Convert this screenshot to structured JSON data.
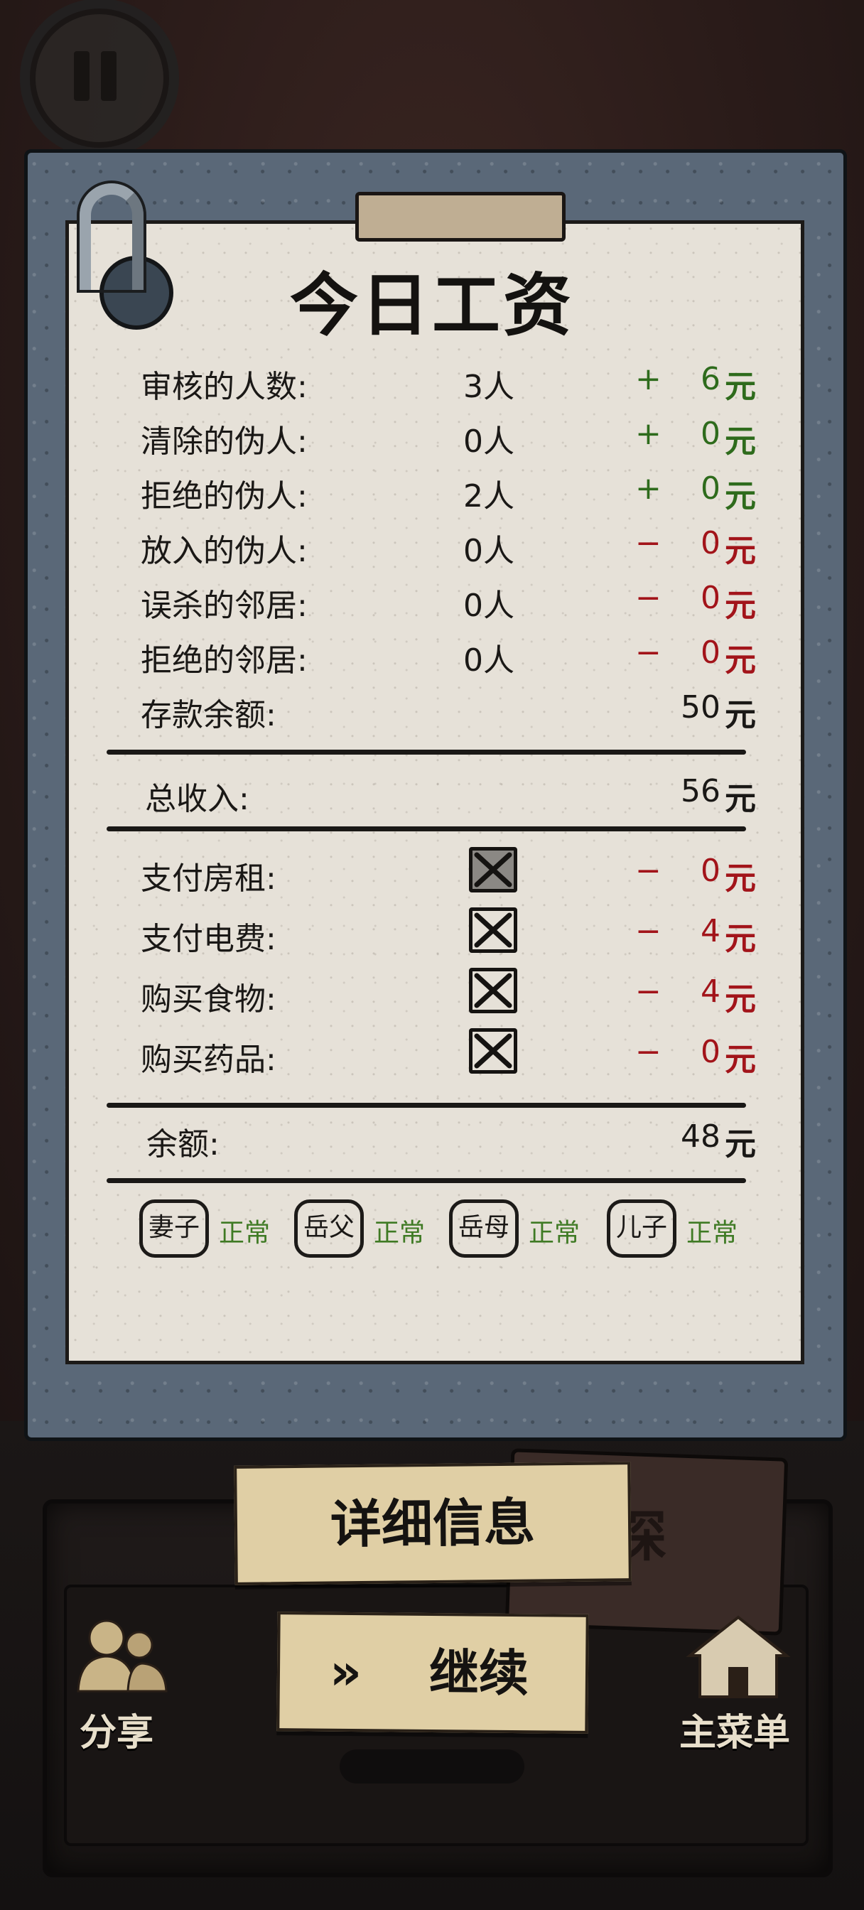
{
  "title": "今日工资",
  "income_rows": [
    {
      "label": "审核的人数:",
      "count": "3人",
      "sign": "+",
      "amount": "6",
      "unit": "元",
      "type": "pos"
    },
    {
      "label": "清除的伪人:",
      "count": "0人",
      "sign": "+",
      "amount": "0",
      "unit": "元",
      "type": "pos"
    },
    {
      "label": "拒绝的伪人:",
      "count": "2人",
      "sign": "+",
      "amount": "0",
      "unit": "元",
      "type": "pos"
    },
    {
      "label": "放入的伪人:",
      "count": "0人",
      "sign": "−",
      "amount": "0",
      "unit": "元",
      "type": "neg"
    },
    {
      "label": "误杀的邻居:",
      "count": "0人",
      "sign": "−",
      "amount": "0",
      "unit": "元",
      "type": "neg"
    },
    {
      "label": "拒绝的邻居:",
      "count": "0人",
      "sign": "−",
      "amount": "0",
      "unit": "元",
      "type": "neg"
    }
  ],
  "savings": {
    "label": "存款余额:",
    "amount": "50",
    "unit": "元"
  },
  "total_income": {
    "label": "总收入:",
    "amount": "56",
    "unit": "元"
  },
  "expenses": [
    {
      "label": "支付房租:",
      "checked": true,
      "disabled": true,
      "sign": "−",
      "amount": "0",
      "unit": "元"
    },
    {
      "label": "支付电费:",
      "checked": true,
      "disabled": false,
      "sign": "−",
      "amount": "4",
      "unit": "元"
    },
    {
      "label": "购买食物:",
      "checked": true,
      "disabled": false,
      "sign": "−",
      "amount": "4",
      "unit": "元"
    },
    {
      "label": "购买药品:",
      "checked": true,
      "disabled": false,
      "sign": "−",
      "amount": "0",
      "unit": "元"
    }
  ],
  "balance": {
    "label": "余额:",
    "amount": "48",
    "unit": "元"
  },
  "family": [
    {
      "name": "妻子",
      "status": "正常"
    },
    {
      "name": "岳父",
      "status": "正常"
    },
    {
      "name": "岳母",
      "status": "正常"
    },
    {
      "name": "儿子",
      "status": "正常"
    }
  ],
  "buttons": {
    "details": "详细信息",
    "continue_arrow": "»",
    "continue": "继续",
    "share": "分享",
    "main_menu": "主菜单"
  },
  "background_book_text": "探",
  "colors": {
    "positive": "#2e6b1c",
    "negative": "#a2141a",
    "status_ok": "#3f7a24",
    "paper": "#e6e1d8",
    "button": "#e0cfa5"
  }
}
